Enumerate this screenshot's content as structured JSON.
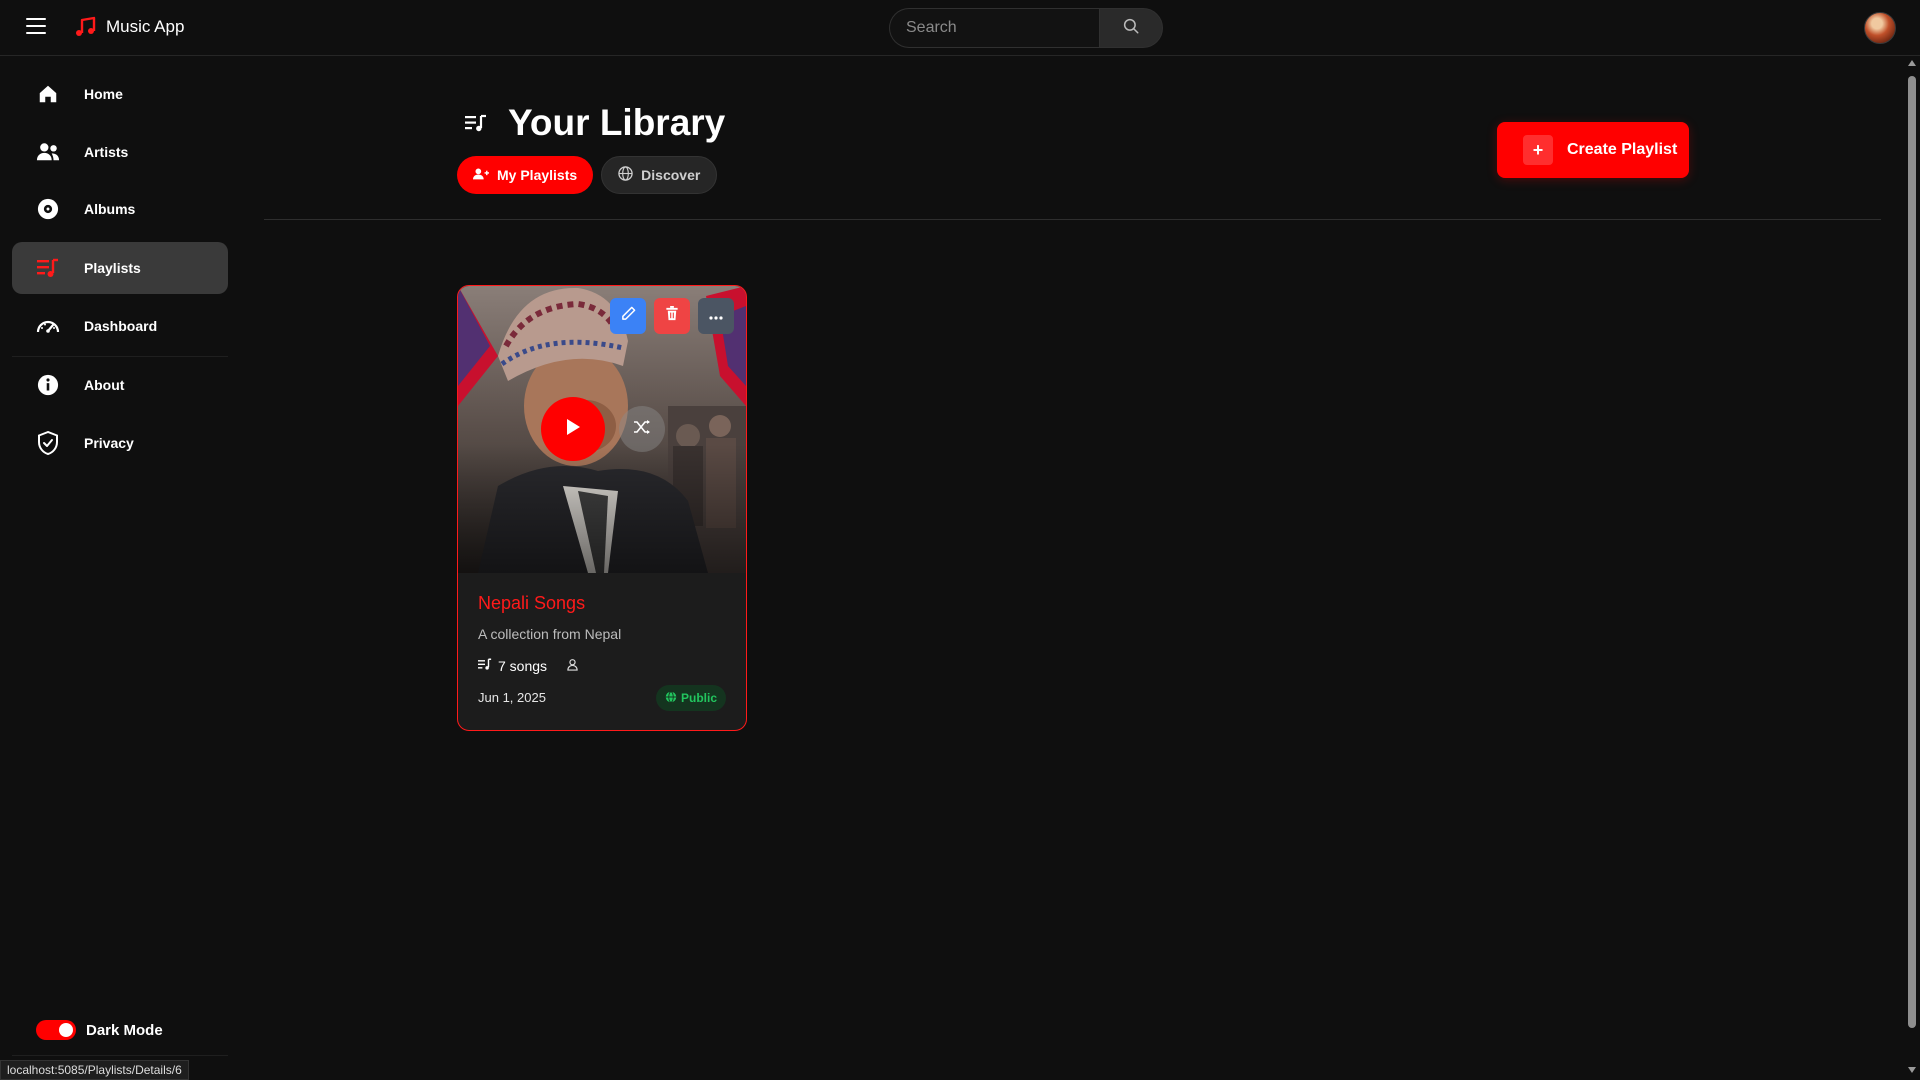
{
  "app": {
    "name": "Music App",
    "brand_color": "#ff0000"
  },
  "search": {
    "placeholder": "Search"
  },
  "sidebar": {
    "items": [
      {
        "label": "Home",
        "icon": "home-icon"
      },
      {
        "label": "Artists",
        "icon": "users-icon"
      },
      {
        "label": "Albums",
        "icon": "disc-icon"
      },
      {
        "label": "Playlists",
        "icon": "playlist-icon",
        "active": true
      },
      {
        "label": "Dashboard",
        "icon": "gauge-icon"
      },
      {
        "label": "About",
        "icon": "info-icon"
      },
      {
        "label": "Privacy",
        "icon": "shield-icon"
      }
    ],
    "theme_toggle": {
      "label": "Dark Mode",
      "on": true
    }
  },
  "library": {
    "title": "Your Library",
    "tabs": [
      {
        "label": "My Playlists",
        "icon": "user-icon",
        "active": true
      },
      {
        "label": "Discover",
        "icon": "globe-icon",
        "active": false
      }
    ],
    "create_button": "Create Playlist"
  },
  "playlists": [
    {
      "title": "Nepali Songs",
      "description": "A collection from Nepal",
      "song_count": "7 songs",
      "date": "Jun 1, 2025",
      "visibility": "Public"
    }
  ],
  "status_bar": {
    "url": "localhost:5085/Playlists/Details/6"
  }
}
